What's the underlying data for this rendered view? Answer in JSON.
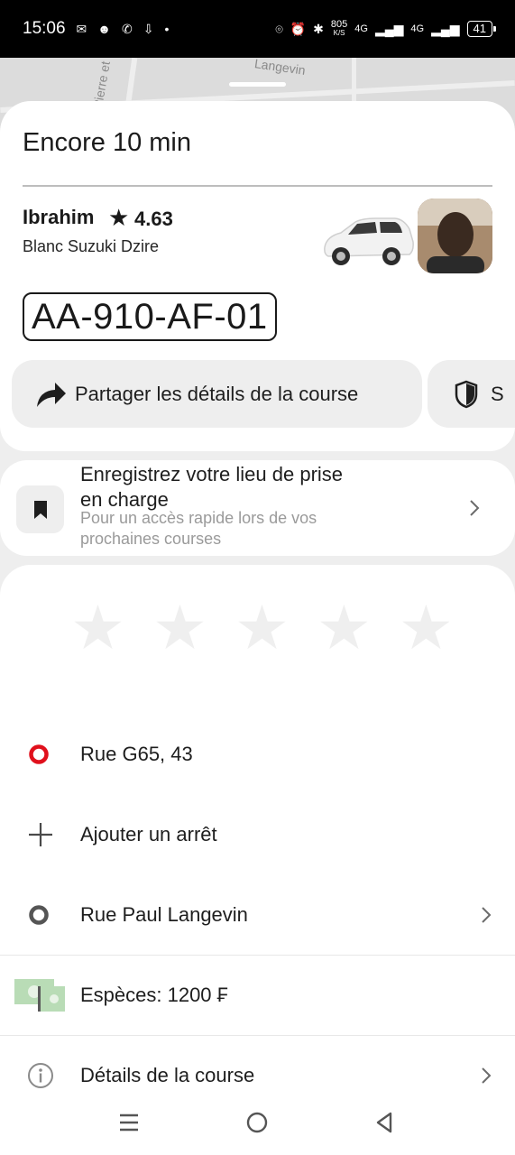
{
  "status_bar": {
    "time": "15:06",
    "net_speed_value": "805",
    "net_speed_unit": "K/S",
    "signal_1": "4G",
    "signal_2": "4G",
    "battery": "41"
  },
  "map": {
    "street_label_1": "Langevin",
    "street_label_2": "Pierre et"
  },
  "trip": {
    "eta": "Encore 10 min",
    "driver_name": "Ibrahim",
    "rating": "4.63",
    "vehicle": "Blanc Suzuki Dzire",
    "plate": "AA-910-AF-01"
  },
  "actions": {
    "share_label": "Partager les détails de la course",
    "safety_label": "S"
  },
  "save_pickup": {
    "title": "Enregistrez votre lieu de prise en charge",
    "subtitle": "Pour un accès rapide lors de vos prochaines courses"
  },
  "rating_prompt": {
    "stars_total": 5,
    "stars_selected": 0
  },
  "route": {
    "pickup": "Rue G65, 43",
    "add_stop": "Ajouter un arrêt",
    "destination": "Rue Paul Langevin"
  },
  "payment": {
    "label": "Espèces: 1200 ₣"
  },
  "details": {
    "label": "Détails de la course"
  },
  "colors": {
    "pickup_ring": "#e0101c",
    "destination_ring": "#555555",
    "cash_green": "#b9dcb6"
  }
}
